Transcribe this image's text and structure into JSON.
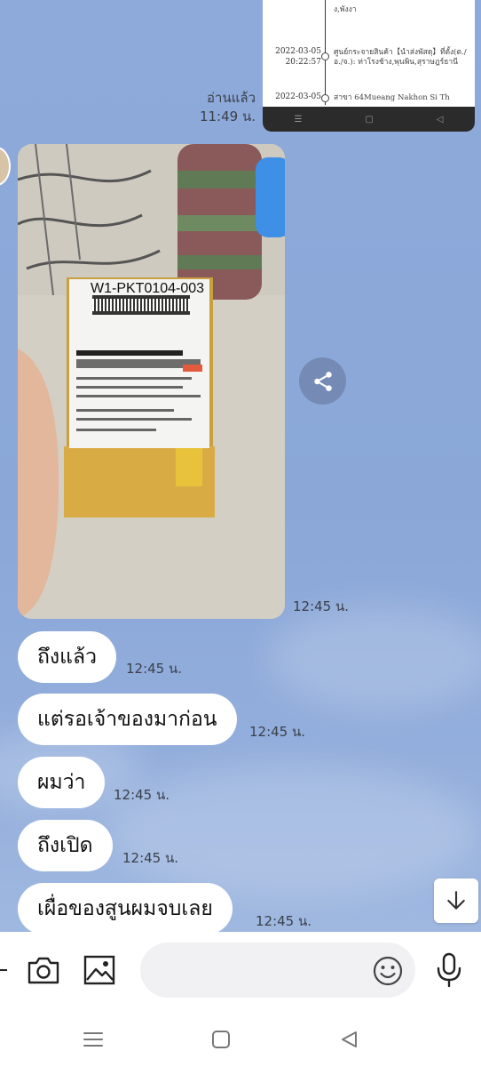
{
  "shared_screenshot": {
    "rows": [
      {
        "date": "",
        "time": "",
        "text": "ง,พังงา"
      },
      {
        "date": "2022-03-05",
        "time": "20:22:57",
        "text": "ศูนย์กระจายสินค้า【นำส่งพัสดุ】ที่ตั้ง(ต./อ./จ.): ท่าโรงช้าง,พุนพิน,สุราษฎร์ธานี"
      },
      {
        "date": "2022-03-05",
        "time": "",
        "text": "สาขา 64Mueang Nakhon Si Th"
      }
    ]
  },
  "messages": {
    "read_status": "อ่านแล้ว",
    "read_time": "11:49 น.",
    "photo_time": "12:45 น.",
    "label_code": "W1-PKT0104-003",
    "texts": [
      {
        "text": "ถึงแล้ว",
        "time": "12:45 น."
      },
      {
        "text": "แต่รอเจ้าของมาก่อน",
        "time": "12:45 น."
      },
      {
        "text": "ผมว่า",
        "time": "12:45 น."
      },
      {
        "text": "ถึงเปิด",
        "time": "12:45 น."
      },
      {
        "text": "เผื่อของสูนผมจบเลย",
        "time": "12:45 น."
      }
    ]
  },
  "input": {
    "placeholder": "",
    "value": ""
  },
  "icons": {
    "share": "share-icon",
    "scroll_down": "arrow-down-icon",
    "camera": "camera-icon",
    "gallery": "image-icon",
    "emoji": "smiley-icon",
    "mic": "microphone-icon",
    "nav_menu": "menu-icon",
    "nav_home": "home-icon",
    "nav_back": "back-icon"
  },
  "colors": {
    "chat_background": "#8da9d8",
    "bubble": "#ffffff"
  }
}
